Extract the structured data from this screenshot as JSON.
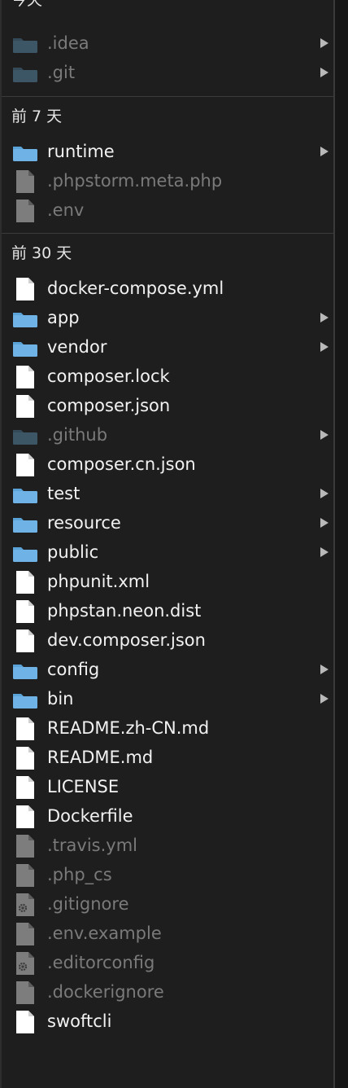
{
  "sections": [
    {
      "title": "今天",
      "items": [
        {
          "name": ".idea",
          "kind": "folder",
          "dim": true,
          "expandable": true
        },
        {
          "name": ".git",
          "kind": "folder",
          "dim": true,
          "expandable": true
        }
      ]
    },
    {
      "title": "前 7 天",
      "items": [
        {
          "name": "runtime",
          "kind": "folder",
          "dim": false,
          "expandable": true
        },
        {
          "name": ".phpstorm.meta.php",
          "kind": "file",
          "dim": true,
          "expandable": false
        },
        {
          "name": ".env",
          "kind": "file",
          "dim": true,
          "expandable": false
        }
      ]
    },
    {
      "title": "前 30 天",
      "items": [
        {
          "name": "docker-compose.yml",
          "kind": "file",
          "dim": false,
          "expandable": false
        },
        {
          "name": "app",
          "kind": "folder",
          "dim": false,
          "expandable": true
        },
        {
          "name": "vendor",
          "kind": "folder",
          "dim": false,
          "expandable": true
        },
        {
          "name": "composer.lock",
          "kind": "file",
          "dim": false,
          "expandable": false
        },
        {
          "name": "composer.json",
          "kind": "file",
          "dim": false,
          "expandable": false
        },
        {
          "name": ".github",
          "kind": "folder",
          "dim": true,
          "expandable": true
        },
        {
          "name": "composer.cn.json",
          "kind": "file",
          "dim": false,
          "expandable": false
        },
        {
          "name": "test",
          "kind": "folder",
          "dim": false,
          "expandable": true
        },
        {
          "name": "resource",
          "kind": "folder",
          "dim": false,
          "expandable": true
        },
        {
          "name": "public",
          "kind": "folder",
          "dim": false,
          "expandable": true
        },
        {
          "name": "phpunit.xml",
          "kind": "file",
          "dim": false,
          "expandable": false
        },
        {
          "name": "phpstan.neon.dist",
          "kind": "file",
          "dim": false,
          "expandable": false
        },
        {
          "name": "dev.composer.json",
          "kind": "file",
          "dim": false,
          "expandable": false
        },
        {
          "name": "config",
          "kind": "folder",
          "dim": false,
          "expandable": true
        },
        {
          "name": "bin",
          "kind": "folder",
          "dim": false,
          "expandable": true
        },
        {
          "name": "README.zh-CN.md",
          "kind": "file",
          "dim": false,
          "expandable": false
        },
        {
          "name": "README.md",
          "kind": "file",
          "dim": false,
          "expandable": false
        },
        {
          "name": "LICENSE",
          "kind": "file",
          "dim": false,
          "expandable": false
        },
        {
          "name": "Dockerfile",
          "kind": "file",
          "dim": false,
          "expandable": false
        },
        {
          "name": ".travis.yml",
          "kind": "file",
          "dim": true,
          "expandable": false
        },
        {
          "name": ".php_cs",
          "kind": "file",
          "dim": true,
          "expandable": false
        },
        {
          "name": ".gitignore",
          "kind": "config-file",
          "dim": true,
          "expandable": false
        },
        {
          "name": ".env.example",
          "kind": "file",
          "dim": true,
          "expandable": false
        },
        {
          "name": ".editorconfig",
          "kind": "config-file",
          "dim": true,
          "expandable": false
        },
        {
          "name": ".dockerignore",
          "kind": "file",
          "dim": true,
          "expandable": false
        },
        {
          "name": "swoftcli",
          "kind": "file",
          "dim": false,
          "expandable": false
        }
      ]
    }
  ],
  "colors": {
    "background": "#1e1e1e",
    "text": "#f2f2f2",
    "dim_text": "#7a7a7a",
    "folder": "#6fb3e6",
    "folder_dim": "#3d5666",
    "file": "#ffffff",
    "file_dim": "#7d7d7d",
    "chevron": "#b9b9b9"
  },
  "icons": {
    "folder": "folder-icon",
    "file": "document-icon",
    "config-file": "gear-document-icon",
    "expand": "disclosure-triangle-icon"
  }
}
